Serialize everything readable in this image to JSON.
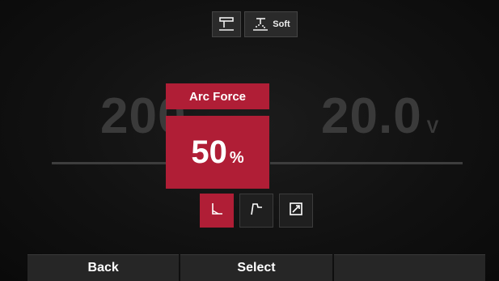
{
  "top_bar": {
    "process_icon": "tig-torch-icon",
    "mode_icon": "stick-spark-icon",
    "mode_label": "Soft"
  },
  "main": {
    "left_value": "200",
    "right_value": "20.0",
    "right_unit": "V"
  },
  "arc_force": {
    "title": "Arc Force",
    "value": "50",
    "unit": "%"
  },
  "curve_modes": [
    {
      "icon": "curve-drop-icon",
      "active": true
    },
    {
      "icon": "curve-step-icon",
      "active": false
    },
    {
      "icon": "curve-ramp-icon",
      "active": false
    }
  ],
  "bottom_bar": {
    "back_label": "Back",
    "select_label": "Select",
    "third_label": ""
  },
  "colors": {
    "accent": "#b01e36",
    "background": "#111111"
  }
}
